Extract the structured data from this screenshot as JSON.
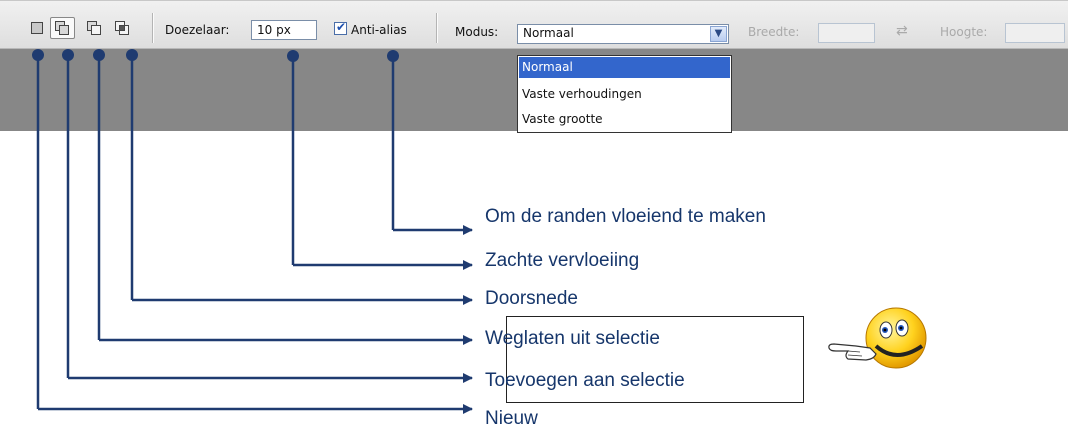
{
  "toolbar": {
    "tools": [
      {
        "name": "new-selection",
        "icon": "new-selection-icon"
      },
      {
        "name": "add-to-selection",
        "icon": "add-selection-icon"
      },
      {
        "name": "subtract-from-selection",
        "icon": "subtract-selection-icon"
      },
      {
        "name": "intersect-with-selection",
        "icon": "intersect-selection-icon"
      }
    ],
    "feather_label": "Doezelaar:",
    "feather_value": "10 px",
    "antialias_label": "Anti-alias",
    "antialias_checked": true,
    "mode_label": "Modus:",
    "mode_value": "Normaal",
    "width_label": "Breedte:",
    "height_label": "Hoogte:"
  },
  "mode_dropdown": {
    "options": [
      "Normaal",
      "Vaste verhoudingen",
      "Vaste grootte"
    ],
    "selected": "Normaal"
  },
  "captions": {
    "antialias": "Om de randen vloeiend te maken",
    "feather": "Zachte vervloeiing",
    "intersect": "Doorsnede",
    "subtract": "Weglaten uit selectie",
    "add": "Toevoegen aan selectie",
    "new": "Nieuw"
  },
  "colors": {
    "connector": "#1f3b70",
    "caption_text": "#16366b",
    "dropdown_highlight": "#3366cc",
    "canvas_gray": "#878787"
  }
}
